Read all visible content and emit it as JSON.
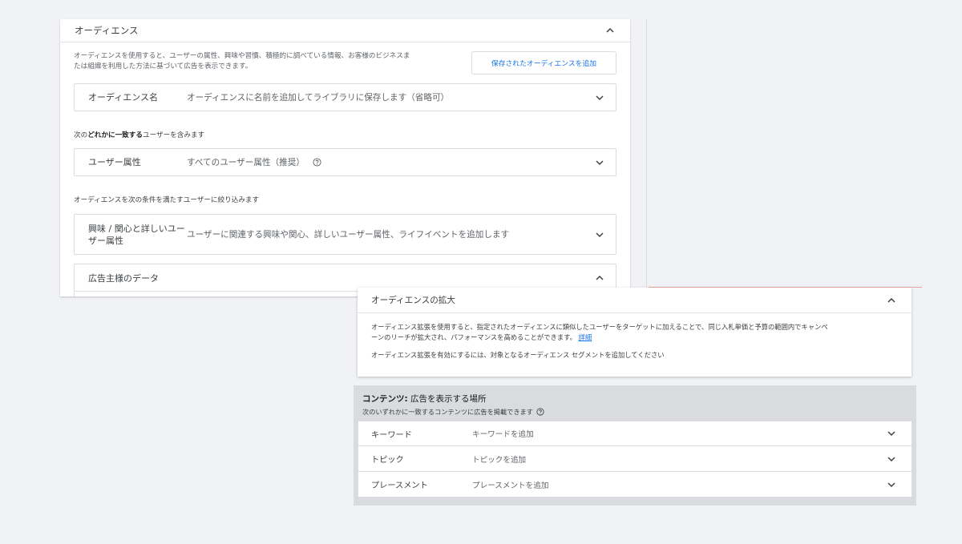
{
  "audience_panel": {
    "title": "オーディエンス",
    "description_line1": "オーディエンスを使用すると、ユーザーの属性、興味や習慣、積極的に調べている情報、お客様のビジネスま",
    "description_line2": "たは組織を利用した方法に基づいて広告を表示できます。",
    "add_saved_button": "保存されたオーディエンスを追加",
    "name_field": {
      "label": "オーディエンス名",
      "value": "オーディエンスに名前を追加してライブラリに保存します（省略可）"
    },
    "include_text_prefix": "次の",
    "include_text_bold": "どれかに一致する",
    "include_text_suffix": "ユーザーを含みます",
    "demographics_field": {
      "label": "ユーザー属性",
      "value": "すべてのユーザー属性（推奨）"
    },
    "narrow_text": "オーディエンスを次の条件を満たすユーザーに絞り込みます",
    "interests_field": {
      "label_line1": "興味 / 関心と詳しいユー",
      "label_line2": "ザー属性",
      "value": "ユーザーに関連する興味や関心、詳しいユーザー属性、ライフイベントを追加します"
    },
    "advertiser_data_field": {
      "label": "広告主様のデータ"
    }
  },
  "expansion_card": {
    "title": "オーディエンスの拡大",
    "text_line1": "オーディエンス拡張を使用すると、指定されたオーディエンスに類似したユーザーをターゲットに加えることで、同じ入札単価と予算の範囲内でキャンペ",
    "text_line2": "ーンのリーチが拡大され、パフォーマンスを高めることができます。",
    "details_link": "詳細",
    "text_enable": "オーディエンス拡張を有効にするには、対象となるオーディエンス セグメントを追加してください"
  },
  "content_section": {
    "title_bold": "コンテンツ:",
    "title_rest": " 広告を表示する場所",
    "subtitle": "次のいずれかに一致するコンテンツに広告を掲載できます",
    "rows": [
      {
        "label": "キーワード",
        "placeholder": "キーワードを追加"
      },
      {
        "label": "トピック",
        "placeholder": "トピックを追加"
      },
      {
        "label": "プレースメント",
        "placeholder": "プレースメントを追加"
      }
    ]
  },
  "icons": {
    "expand": "chevron-down-icon",
    "collapse": "chevron-up-icon",
    "help": "help-circle-icon"
  },
  "colors": {
    "link": "#1a73e8",
    "background": "#f1f2f5",
    "content_section_bg": "#dadbde",
    "accent_line": "#e8a29c"
  }
}
